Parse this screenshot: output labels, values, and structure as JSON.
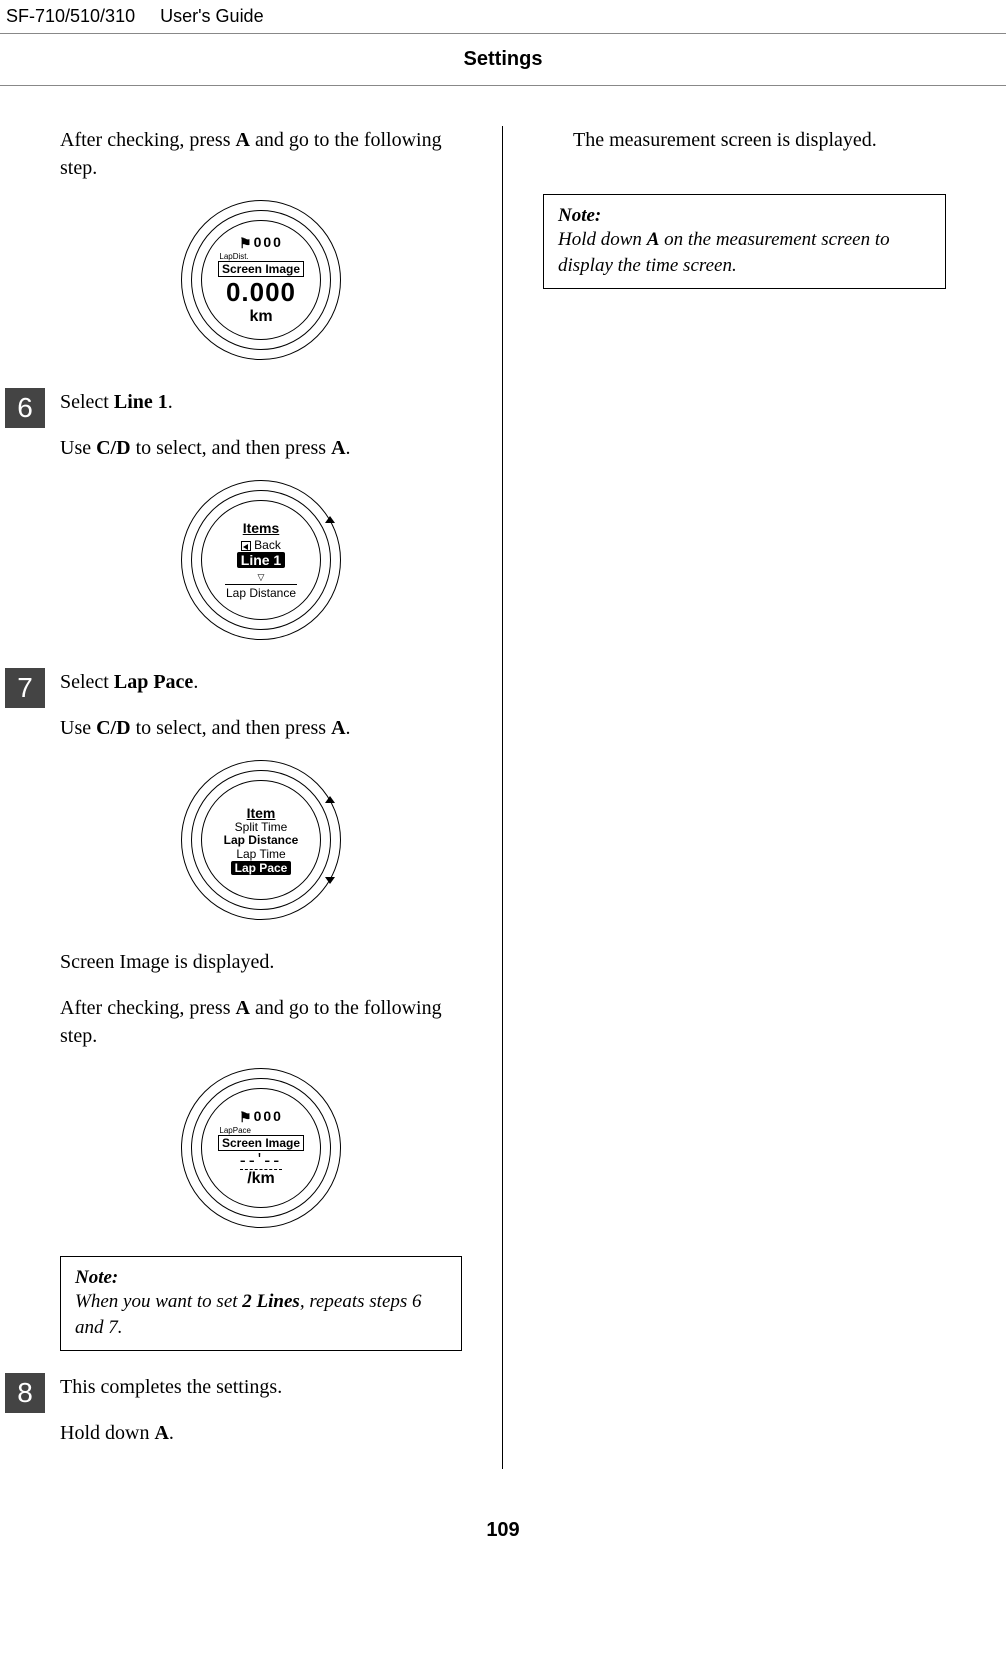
{
  "header": {
    "model": "SF-710/510/310",
    "guide": "User's Guide"
  },
  "section_title": "Settings",
  "page_number": "109",
  "left": {
    "intro": {
      "pre": "After checking, press ",
      "key": "A",
      "post": " and go to the following step."
    },
    "fig1": {
      "flag": "⚑",
      "digits": "000",
      "label": "LapDist.",
      "boxed": "Screen Image",
      "big": "0.000",
      "unit": "km"
    },
    "step6": {
      "num": "6",
      "line1": {
        "pre": "Select ",
        "bold": "Line 1",
        "post": "."
      },
      "line2": {
        "pre": "Use ",
        "bold": "C/D",
        "mid": " to select, and then press ",
        "bold2": "A",
        "post": "."
      },
      "fig": {
        "title": "Items",
        "back": "Back",
        "selected": "Line 1",
        "sub": "Lap Distance"
      }
    },
    "step7": {
      "num": "7",
      "line1": {
        "pre": "Select ",
        "bold": "Lap Pace",
        "post": "."
      },
      "line2": {
        "pre": "Use ",
        "bold": "C/D",
        "mid": " to select, and then press ",
        "bold2": "A",
        "post": "."
      },
      "fig": {
        "title": "Item",
        "rows": [
          "Split Time",
          "Lap Distance",
          "Lap Time"
        ],
        "selected": "Lap Pace"
      },
      "after1": "Screen Image is displayed.",
      "after2": {
        "pre": "After checking, press ",
        "key": "A",
        "post": " and go to the following step."
      },
      "fig2": {
        "flag": "⚑",
        "digits": "000",
        "label": "LapPace",
        "boxed": "Screen Image",
        "dash": "--'--",
        "unit": "/km"
      },
      "note": {
        "label": "Note:",
        "pre": "When you want to set ",
        "bold": "2 Lines",
        "post": ", repeats steps 6 and 7."
      }
    },
    "step8": {
      "num": "8",
      "line1": "This completes the settings.",
      "line2": {
        "pre": "Hold down ",
        "bold": "A",
        "post": "."
      }
    }
  },
  "right": {
    "intro": "The measurement screen is displayed.",
    "note": {
      "label": "Note:",
      "pre": "Hold down ",
      "bold": "A",
      "post": " on the measurement screen to display the time screen."
    }
  }
}
